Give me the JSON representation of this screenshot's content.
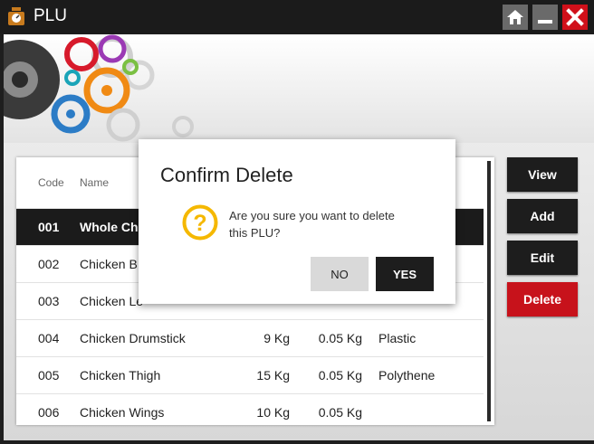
{
  "window": {
    "title": "PLU",
    "colors": {
      "close": "#d0101a",
      "accent_delete": "#c7121b",
      "dark": "#1d1d1d",
      "question_icon": "#f5b800"
    },
    "icons": {
      "app": "scale-icon",
      "home": "home-icon",
      "minimize": "minimize-icon",
      "close": "close-icon"
    }
  },
  "table": {
    "headers": {
      "code": "Code",
      "name": "Name"
    },
    "rows": [
      {
        "code": "001",
        "name": "Whole Chi",
        "weight": "",
        "tare": "",
        "packing": ""
      },
      {
        "code": "002",
        "name": "Chicken B",
        "weight": "",
        "tare": "",
        "packing": ""
      },
      {
        "code": "003",
        "name": "Chicken Le",
        "weight": "",
        "tare": "",
        "packing": ""
      },
      {
        "code": "004",
        "name": "Chicken Drumstick",
        "weight": "9 Kg",
        "tare": "0.05 Kg",
        "packing": "Plastic"
      },
      {
        "code": "005",
        "name": "Chicken Thigh",
        "weight": "15 Kg",
        "tare": "0.05 Kg",
        "packing": "Polythene"
      },
      {
        "code": "006",
        "name": "Chicken Wings",
        "weight": "10 Kg",
        "tare": "0.05 Kg",
        "packing": ""
      }
    ]
  },
  "actions": {
    "view": "View",
    "add": "Add",
    "edit": "Edit",
    "delete": "Delete"
  },
  "dialog": {
    "title": "Confirm Delete",
    "message": "Are you sure you want to delete this PLU?",
    "no": "NO",
    "yes": "YES",
    "icon": "question-icon"
  }
}
